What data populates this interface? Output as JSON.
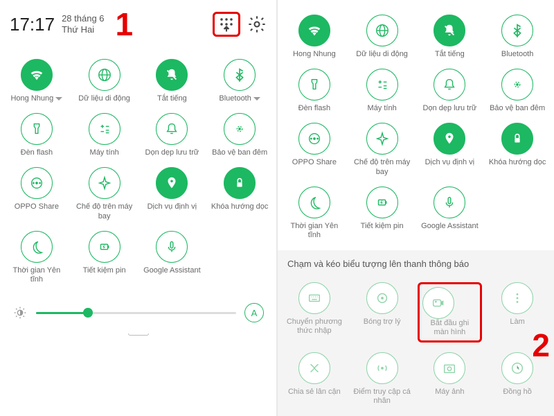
{
  "statusbar": {
    "time": "17:17",
    "date_line1": "28 tháng 6",
    "date_line2": "Thứ Hai"
  },
  "annotations": {
    "one": "1",
    "two": "2"
  },
  "left": {
    "tiles": [
      {
        "label": "Hong Nhung",
        "icon": "wifi",
        "on": true,
        "expand": true
      },
      {
        "label": "Dữ liệu di động",
        "icon": "globe",
        "on": false
      },
      {
        "label": "Tắt tiếng",
        "icon": "bell-off",
        "on": true
      },
      {
        "label": "Bluetooth",
        "icon": "bluetooth",
        "on": false,
        "expand": true
      },
      {
        "label": "Đèn flash",
        "icon": "flashlight",
        "on": false
      },
      {
        "label": "Máy tính",
        "icon": "calc",
        "on": false
      },
      {
        "label": "Dọn dẹp lưu trữ",
        "icon": "bell",
        "on": false
      },
      {
        "label": "Bảo vệ ban đêm",
        "icon": "night",
        "on": false
      },
      {
        "label": "OPPO Share",
        "icon": "share",
        "on": false
      },
      {
        "label": "Chế độ trên máy bay",
        "icon": "plane",
        "on": false
      },
      {
        "label": "Dịch vụ định vị",
        "icon": "location",
        "on": true
      },
      {
        "label": "Khóa hướng dọc",
        "icon": "lock",
        "on": true
      },
      {
        "label": "Thời gian Yên tĩnh",
        "icon": "moon",
        "on": false
      },
      {
        "label": "Tiết kiệm pin",
        "icon": "battery",
        "on": false
      },
      {
        "label": "Google Assistant",
        "icon": "mic",
        "on": false
      }
    ],
    "auto": "A"
  },
  "right": {
    "tiles": [
      {
        "label": "Hong Nhung",
        "icon": "wifi",
        "on": true
      },
      {
        "label": "Dữ liệu di động",
        "icon": "globe",
        "on": false
      },
      {
        "label": "Tắt tiếng",
        "icon": "bell-off",
        "on": true
      },
      {
        "label": "Bluetooth",
        "icon": "bluetooth",
        "on": false
      },
      {
        "label": "Đèn flash",
        "icon": "flashlight",
        "on": false
      },
      {
        "label": "Máy tính",
        "icon": "calc",
        "on": false
      },
      {
        "label": "Dọn dẹp lưu trữ",
        "icon": "bell",
        "on": false
      },
      {
        "label": "Bảo vệ ban đêm",
        "icon": "night",
        "on": false
      },
      {
        "label": "OPPO Share",
        "icon": "share",
        "on": false
      },
      {
        "label": "Chế độ trên máy bay",
        "icon": "plane",
        "on": false
      },
      {
        "label": "Dịch vụ định vị",
        "icon": "location",
        "on": true
      },
      {
        "label": "Khóa hướng dọc",
        "icon": "lock",
        "on": true
      },
      {
        "label": "Thời gian Yên tĩnh",
        "icon": "moon",
        "on": false
      },
      {
        "label": "Tiết kiệm pin",
        "icon": "battery",
        "on": false
      },
      {
        "label": "Google Assistant",
        "icon": "mic",
        "on": false
      }
    ],
    "hint": "Chạm và kéo biểu tượng lên thanh thông báo",
    "available": [
      {
        "label": "Chuyển phương thức nhập",
        "icon": "keyboard"
      },
      {
        "label": "Bóng trợ lý",
        "icon": "target"
      },
      {
        "label": "Bắt đầu ghi màn hình",
        "icon": "record",
        "highlight": true
      },
      {
        "label": "Làm",
        "icon": "dots"
      },
      {
        "label": "Chia sẻ lân cận",
        "icon": "dna"
      },
      {
        "label": "Điểm truy cập cá nhân",
        "icon": "hotspot"
      },
      {
        "label": "Máy ảnh",
        "icon": "camera"
      },
      {
        "label": "Đồng hồ",
        "icon": "clock"
      }
    ]
  }
}
